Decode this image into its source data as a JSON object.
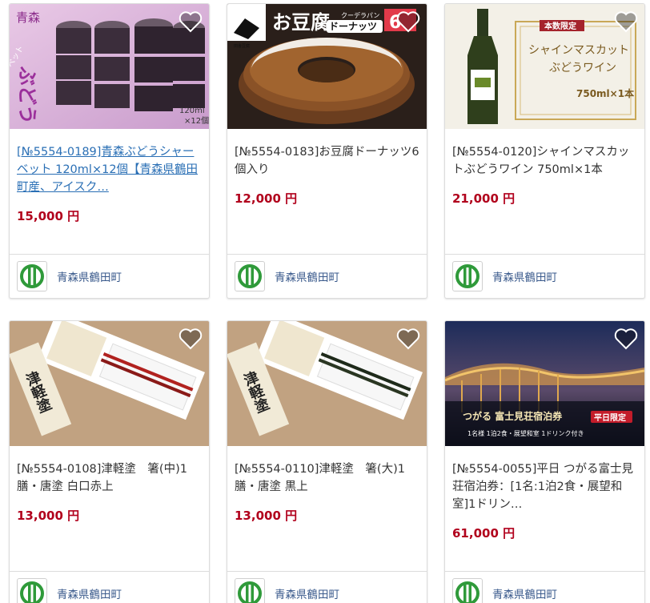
{
  "products": [
    {
      "title": "[№5554-0189]青森ぶどうシャーベット 120ml×12個【青森県鶴田町産、アイスク…",
      "price": "15,000 円",
      "municipality": "青森県鶴田町",
      "visited": true,
      "image_texts": {
        "a": "青森",
        "b": "ぶどう",
        "c": "シャーベット",
        "d": "120ml",
        "e": "×12個"
      }
    },
    {
      "title": "[№5554-0183]お豆腐ドーナッツ6個入り",
      "price": "12,000 円",
      "municipality": "青森県鶴田町",
      "visited": false,
      "image_texts": {
        "a": "お豆腐",
        "b": "ドーナッツ",
        "c": "クーデラパン",
        "d": "6"
      }
    },
    {
      "title": "[№5554-0120]シャインマスカットぶどうワイン 750ml×1本",
      "price": "21,000 円",
      "municipality": "青森県鶴田町",
      "visited": false,
      "image_texts": {
        "a": "本数限定",
        "b": "シャインマスカット",
        "c": "ぶどうワイン",
        "d": "750ml×1本"
      }
    },
    {
      "title": "[№5554-0108]津軽塗　箸(中)1膳・唐塗 白口赤上",
      "price": "13,000 円",
      "municipality": "青森県鶴田町",
      "visited": false,
      "image_texts": {
        "a": "津軽塗"
      }
    },
    {
      "title": "[№5554-0110]津軽塗　箸(大)1膳・唐塗 黒上",
      "price": "13,000 円",
      "municipality": "青森県鶴田町",
      "visited": false,
      "image_texts": {
        "a": "津軽塗"
      }
    },
    {
      "title": "[№5554-0055]平日 つがる富士見荘宿泊券：[1名:1泊2食・展望和室]1ドリン…",
      "price": "61,000 円",
      "municipality": "青森県鶴田町",
      "visited": false,
      "image_texts": {
        "a": "つがる 富士見荘宿泊券",
        "b": "平日限定",
        "c": "1名様 1泊2食・展望和室 1ドリンク付き"
      }
    }
  ],
  "colors": {
    "price": "#b1001c",
    "link": "#2a6fb5",
    "municipality": "#3a5a8c",
    "logo_green": "#2f9a3a"
  }
}
